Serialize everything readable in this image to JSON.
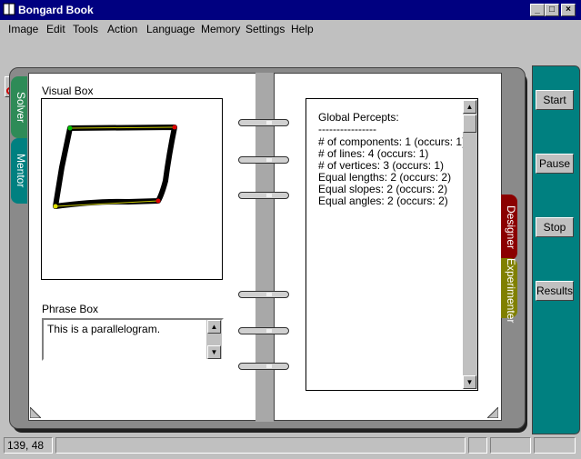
{
  "window": {
    "title": "Bongard Book",
    "minimize_glyph": "_",
    "maximize_glyph": "□",
    "close_glyph": "×"
  },
  "menu": [
    "Image",
    "Edit",
    "Tools",
    "Action",
    "Language",
    "Memory",
    "Settings",
    "Help"
  ],
  "toolbar": [
    "scissors-icon",
    "magnifier-icon",
    "eraser-icon",
    "fill-bucket-icon",
    "text-tool-icon",
    "brush-icon",
    "pencil-icon",
    "line-icon",
    "rectangle-icon",
    "ellipse-icon"
  ],
  "tabs": {
    "left": [
      "Solver",
      "Mentor"
    ],
    "right": [
      "Designer",
      "Experimenter"
    ]
  },
  "visual_box": {
    "label": "Visual Box"
  },
  "phrase_box": {
    "label": "Phrase Box",
    "text": "This is a parallelogram."
  },
  "percepts": {
    "title": "Global Percepts:",
    "separator": "----------------",
    "lines": [
      "# of components: 1  (occurs: 1)",
      "# of lines: 4  (occurs: 1)",
      "# of vertices: 3  (occurs: 1)",
      "Equal lengths: 2  (occurs: 2)",
      "Equal slopes: 2  (occurs: 2)",
      "Equal angles: 2  (occurs: 2)"
    ]
  },
  "side_buttons": [
    "Start",
    "Pause",
    "Stop",
    "Results"
  ],
  "status": {
    "coords": "139, 48"
  },
  "colors": {
    "title_bar": "#000080",
    "side_panel": "#008080",
    "solver_tab": "#2e8b57",
    "mentor_tab": "#008080",
    "designer_tab": "#8b0000",
    "experimenter_tab": "#808000"
  }
}
